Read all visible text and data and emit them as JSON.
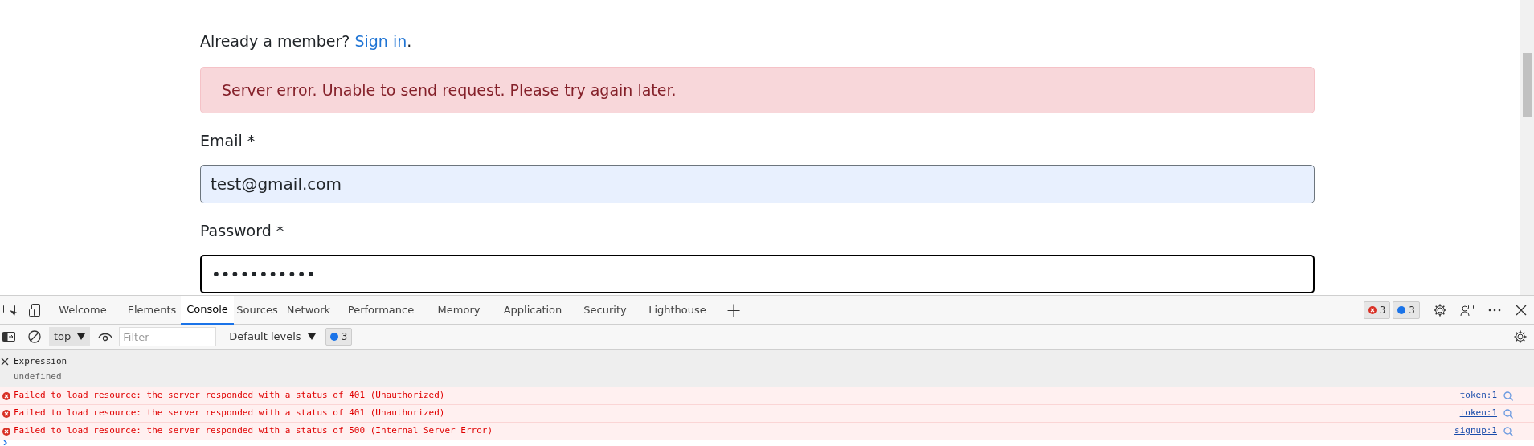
{
  "page": {
    "member_prompt": "Already a member? ",
    "sign_in_link": "Sign in",
    "member_suffix": ".",
    "alert": "Server error. Unable to send request. Please try again later.",
    "fields": [
      {
        "label": "Email *",
        "value": "test@gmail.com",
        "autofilled": true,
        "focused": false
      },
      {
        "label": "Password *",
        "value": "•••••••••••",
        "autofilled": false,
        "focused": true
      }
    ]
  },
  "devtools": {
    "tabs": [
      {
        "label": "Welcome",
        "selected": false
      },
      {
        "label": "Elements",
        "selected": false
      },
      {
        "label": "Console",
        "selected": true
      },
      {
        "label": "Sources",
        "selected": false
      },
      {
        "label": "Network",
        "selected": false
      },
      {
        "label": "Performance",
        "selected": false
      },
      {
        "label": "Memory",
        "selected": false
      },
      {
        "label": "Application",
        "selected": false
      },
      {
        "label": "Security",
        "selected": false
      },
      {
        "label": "Lighthouse",
        "selected": false
      }
    ],
    "add_tab": "+",
    "error_count": "3",
    "message_count": "3",
    "toolbar": {
      "context": "top",
      "filter_placeholder": "Filter",
      "levels": "Default levels",
      "message_count": "3"
    },
    "expression": {
      "label": "Expression",
      "value": "undefined"
    },
    "messages": [
      {
        "text": "Failed to load resource: the server responded with a status of 401 (Unauthorized)",
        "source": "token:1"
      },
      {
        "text": "Failed to load resource: the server responded with a status of 401 (Unauthorized)",
        "source": "token:1"
      },
      {
        "text": "Failed to load resource: the server responded with a status of 500 (Internal Server Error)",
        "source": "signup:1"
      }
    ]
  }
}
